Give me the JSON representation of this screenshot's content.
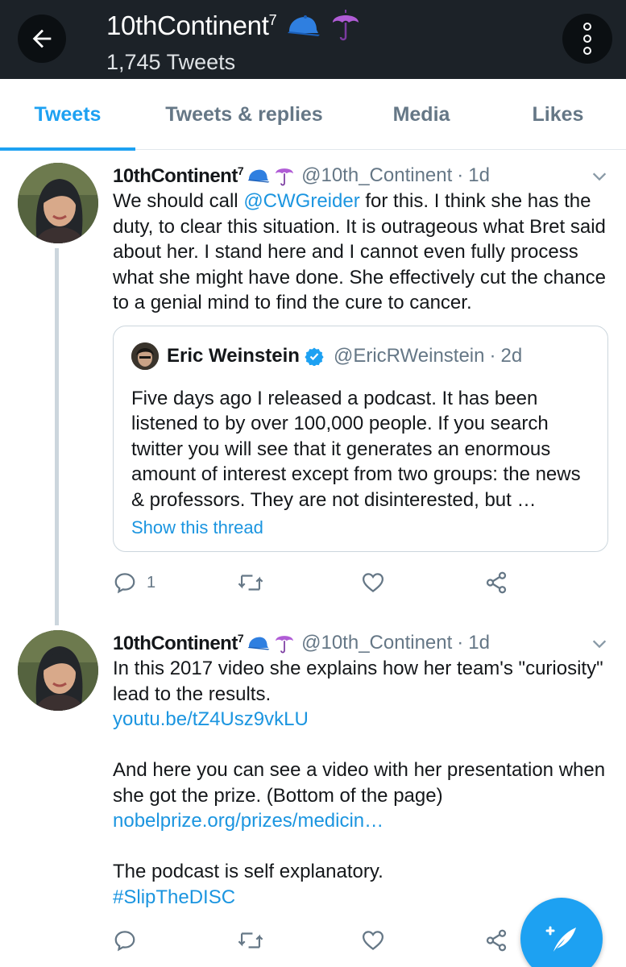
{
  "header": {
    "title": "10thContinent",
    "title_sup": "7",
    "tweet_count": "1,745 Tweets",
    "back_icon": "arrow-left-icon",
    "more_icon": "vertical-dots-icon",
    "emoji": [
      "blue-cap-emoji",
      "purple-umbrella-emoji"
    ]
  },
  "tabs": [
    {
      "label": "Tweets",
      "active": true
    },
    {
      "label": "Tweets & replies",
      "active": false
    },
    {
      "label": "Media",
      "active": false
    },
    {
      "label": "Likes",
      "active": false
    }
  ],
  "tweets": [
    {
      "name": "10thContinent",
      "name_sup": "7",
      "handle": "@10th_Continent",
      "dot": "·",
      "time": "1d",
      "text_parts": {
        "before": "We should call ",
        "mention": "@CWGreider",
        "after": " for this. I think she has the duty, to clear this situation. It is outrageous what Bret said about her. I stand here and I cannot even fully process what she might have done. She effectively cut the chance to a genial mind to find the cure to cancer."
      },
      "quote": {
        "name": "Eric Weinstein",
        "handle": "@EricRWeinstein",
        "dot": "·",
        "time": "2d",
        "text": "Five days ago I released a podcast. It has been listened to by over 100,000 people. If you search twitter you will see that it generates an enormous amount of interest except from two groups: the news & professors. They are not disinterested, but …",
        "link": "Show this thread"
      },
      "actions": {
        "reply_count": "1",
        "retweet_count": "",
        "like_count": ""
      }
    },
    {
      "name": "10thContinent",
      "name_sup": "7",
      "handle": "@10th_Continent",
      "dot": "·",
      "time": "1d",
      "para1": "In this 2017 video she explains how her team's \"curiosity\" lead to the results.",
      "link1": "youtu.be/tZ4Usz9vkLU",
      "para2": "And here you can see a video with her presentation when she got the prize. (Bottom of the page)",
      "link2": "nobelprize.org/prizes/medicin…",
      "para3": "The podcast is self explanatory.",
      "hashtag": "#SlipTheDISC",
      "actions": {
        "reply_count": "",
        "retweet_count": "",
        "like_count": ""
      }
    }
  ],
  "fab": {
    "icon": "compose-feather-icon"
  },
  "colors": {
    "accent": "#1da1f2",
    "topbar": "#1c2228",
    "muted": "#657786",
    "link": "#1b95e0"
  }
}
